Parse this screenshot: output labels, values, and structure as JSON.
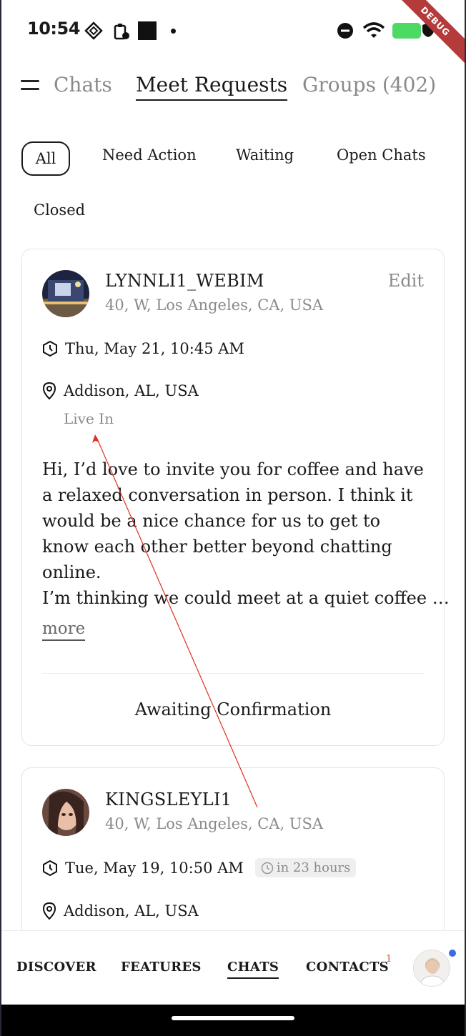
{
  "status_bar": {
    "time": "10:54",
    "debug_label": "DEBUG"
  },
  "top_tabs": [
    {
      "label": "Chats"
    },
    {
      "label": "Meet Requests"
    },
    {
      "label": "Groups (402)"
    }
  ],
  "filters": [
    {
      "label": "All"
    },
    {
      "label": "Need Action"
    },
    {
      "label": "Waiting"
    },
    {
      "label": "Open Chats"
    },
    {
      "label": "Closed"
    }
  ],
  "cards": [
    {
      "username": "LYNNLI1_WEBIM",
      "info": "40, W, Los Angeles, CA, USA",
      "edit_label": "Edit",
      "datetime": "Thu, May 21, 10:45 AM",
      "location": "Addison, AL, USA",
      "location_type": "Live In",
      "message_p1": "Hi, I’d love to invite you for coffee and have a relaxed conversation in person. I think it would be a nice chance for us to get to know each other better beyond chatting online.",
      "message_p2": "I’m thinking we could meet at a quiet coffee …",
      "more_label": "more",
      "status": "Awaiting Confirmation"
    },
    {
      "username": "KINGSLEYLI1",
      "info": "40, W, Los Angeles, CA, USA",
      "datetime": "Tue, May 19, 10:50 AM",
      "time_badge": "in 23 hours",
      "location": "Addison, AL, USA"
    }
  ],
  "bottom_nav": [
    {
      "label": "DISCOVER"
    },
    {
      "label": "FEATURES"
    },
    {
      "label": "CHATS"
    },
    {
      "label": "CONTACTS"
    }
  ],
  "contacts_badge": "1",
  "colors": {
    "accent_line": "#1a1a1a",
    "muted_text": "#8a8a8a",
    "annotation_arrow": "#e03020",
    "notification_dot": "#3a6ee0"
  }
}
